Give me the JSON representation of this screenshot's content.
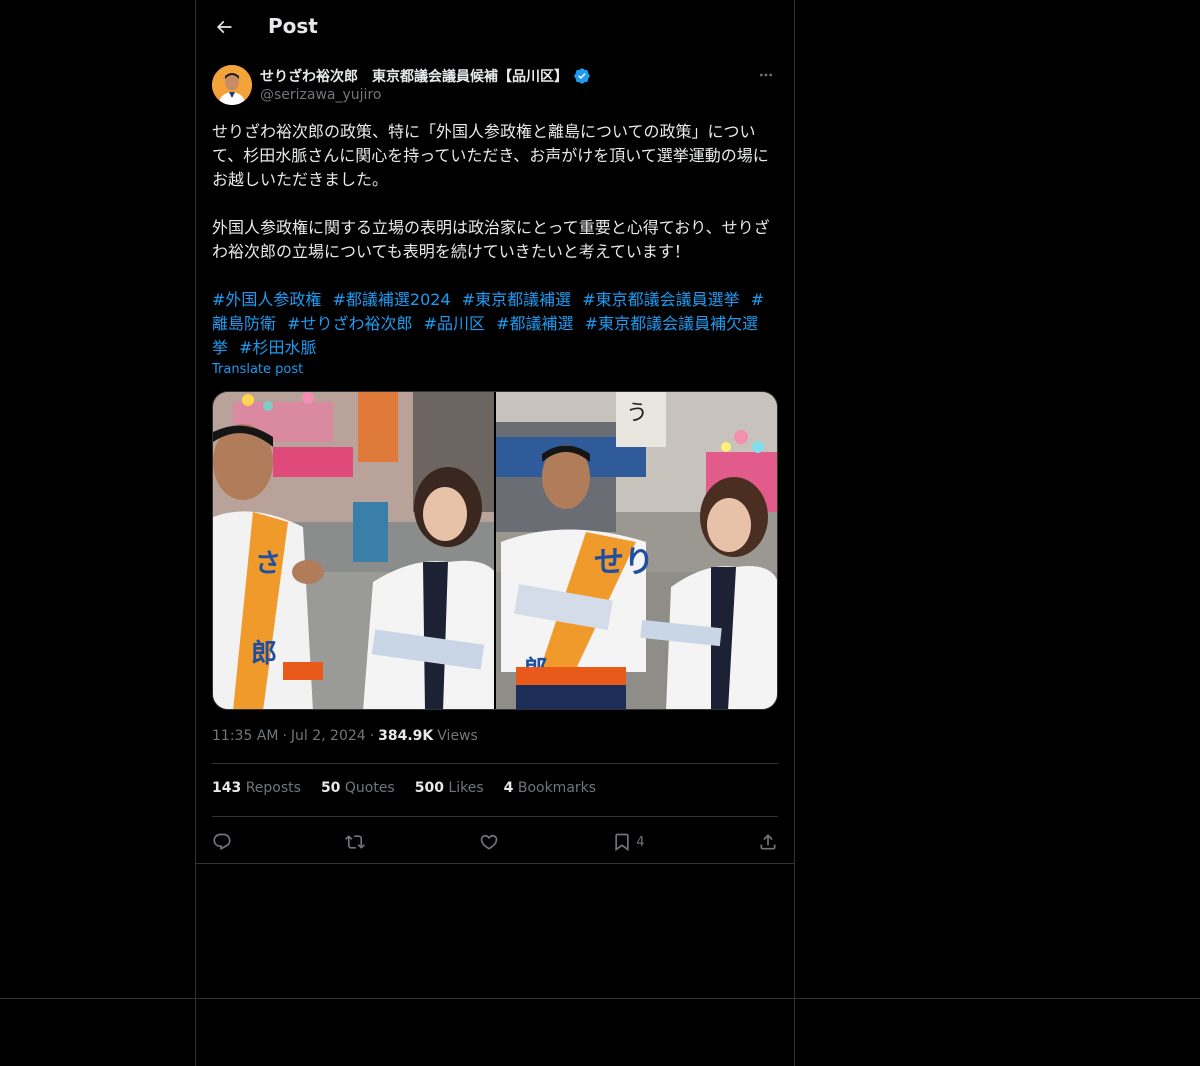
{
  "header": {
    "title": "Post",
    "back_icon": "arrow-left-icon"
  },
  "author": {
    "name": "せりざわ裕次郎　東京都議会議員候補【品川区】",
    "handle": "@serizawa_yujiro",
    "verified_icon": "verified-badge-icon",
    "verified_color": "#1d9bf0",
    "avatar_bg": "#f2a33a"
  },
  "post": {
    "text": "せりざわ裕次郎の政策、特に「外国人参政権と離島についての政策」について、杉田水脈さんに関心を持っていただき、お声がけを頂いて選挙運動の場にお越しいただきました。\n\n外国人参政権に関する立場の表明は政治家にとって重要と心得ており、せりざわ裕次郎の立場についても表明を続けていきたいと考えています！",
    "hashtags": [
      "#外国人参政権",
      "#都議補選2024",
      "#東京都議補選",
      "#東京都議会議員選挙",
      "#離島防衛",
      "#せりざわ裕次郎",
      "#品川区",
      "#都議補選",
      "#東京都議会議員補欠選挙",
      "#杉田水脈"
    ],
    "translate_label": "Translate post"
  },
  "meta": {
    "time": "11:35 AM",
    "sep1": "·",
    "date": "Jul 2, 2024",
    "sep2": "·",
    "views_count": "384.9K",
    "views_label": "Views"
  },
  "stats": [
    {
      "count": "143",
      "label": "Reposts"
    },
    {
      "count": "50",
      "label": "Quotes"
    },
    {
      "count": "500",
      "label": "Likes"
    },
    {
      "count": "4",
      "label": "Bookmarks"
    }
  ],
  "actions": {
    "reply_icon": "reply-icon",
    "repost_icon": "repost-icon",
    "like_icon": "heart-icon",
    "bookmark_icon": "bookmark-icon",
    "bookmark_count": "4",
    "share_icon": "share-icon"
  },
  "colors": {
    "background": "#000000",
    "text": "#e7e9ea",
    "muted": "#71767b",
    "link": "#1d9bf0",
    "border": "#2f3336"
  }
}
